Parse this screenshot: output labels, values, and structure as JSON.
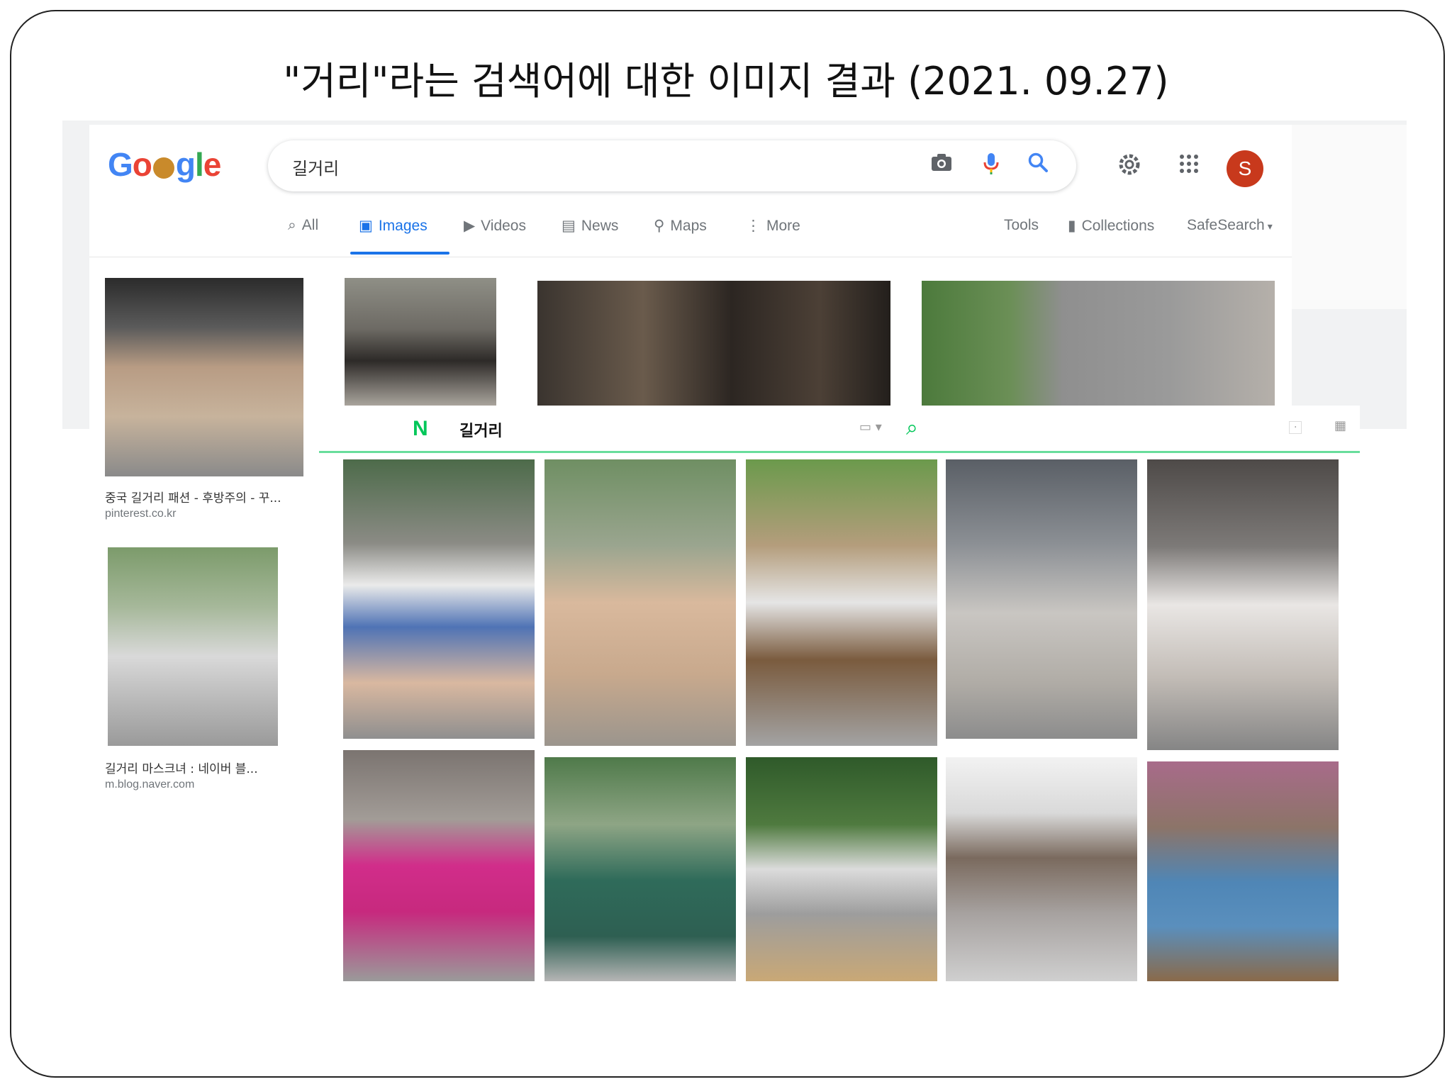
{
  "slide": {
    "title": "\"거리\"라는 검색어에 대한 이미지 결과 (2021. 09.27)"
  },
  "google": {
    "logo": "Google",
    "search": {
      "value": "길거리",
      "icons": [
        "camera-icon",
        "microphone-icon",
        "search-icon"
      ]
    },
    "header_icons": [
      "settings-icon",
      "apps-grid-icon"
    ],
    "avatar_letter": "S",
    "tabs": [
      {
        "label": "All",
        "icon": "search-icon",
        "active": false
      },
      {
        "label": "Images",
        "icon": "image-icon",
        "active": true
      },
      {
        "label": "Videos",
        "icon": "video-icon",
        "active": false
      },
      {
        "label": "News",
        "icon": "news-icon",
        "active": false
      },
      {
        "label": "Maps",
        "icon": "map-pin-icon",
        "active": false
      },
      {
        "label": "More",
        "icon": "more-vert-icon",
        "active": false
      }
    ],
    "tools": "Tools",
    "collections": "Collections",
    "safesearch": "SafeSearch",
    "results": [
      {
        "caption": "중국 길거리 패션 - 후방주의 - 꾸...",
        "source": "pinterest.co.kr"
      },
      {
        "caption": "길거리 마스크녀 : 네이버 블...",
        "source": "m.blog.naver.com"
      }
    ],
    "colors": {
      "accent": "#1a73e8",
      "text": "#70757a",
      "avatar": "#c8391c"
    }
  },
  "naver": {
    "logo": "N",
    "query": "길거리",
    "accent": "#03c75a"
  }
}
